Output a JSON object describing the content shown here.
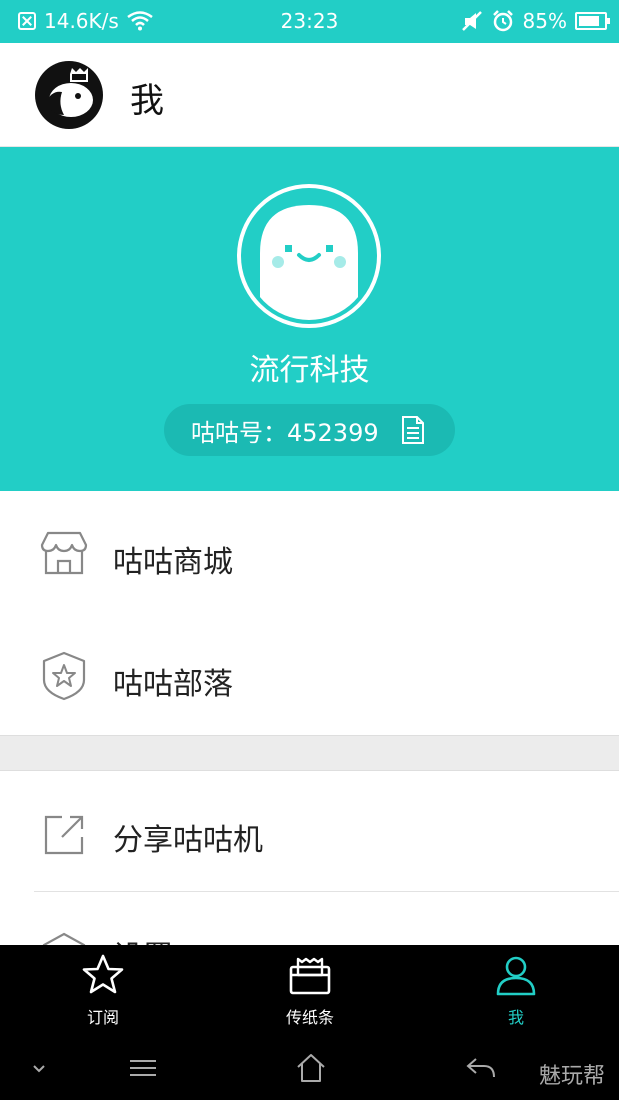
{
  "status_bar": {
    "net_speed": "14.6K/s",
    "time": "23:23",
    "battery": "85%",
    "battery_level": 0.85,
    "icons": [
      "no-sim-icon",
      "wifi-icon",
      "mute-icon",
      "alarm-icon",
      "battery-icon"
    ]
  },
  "header": {
    "title": "我"
  },
  "profile": {
    "name": "流行科技",
    "id_label": "咕咕号：452399"
  },
  "menu": [
    {
      "label": "咕咕商城",
      "icon": "store-icon"
    },
    {
      "label": "咕咕部落",
      "icon": "shield-star-icon"
    },
    {
      "label": "分享咕咕机",
      "icon": "share-icon"
    },
    {
      "label": "设置",
      "icon": "settings-icon"
    }
  ],
  "bottom_nav": [
    {
      "label": "订阅",
      "icon": "star-icon",
      "active": false
    },
    {
      "label": "传纸条",
      "icon": "paper-note-icon",
      "active": false
    },
    {
      "label": "我",
      "icon": "person-icon",
      "active": true
    }
  ],
  "colors": {
    "accent": "#22cec6",
    "accent_dark": "#1bbab3",
    "nav_bg": "#000000"
  },
  "watermark": "魅玩帮"
}
